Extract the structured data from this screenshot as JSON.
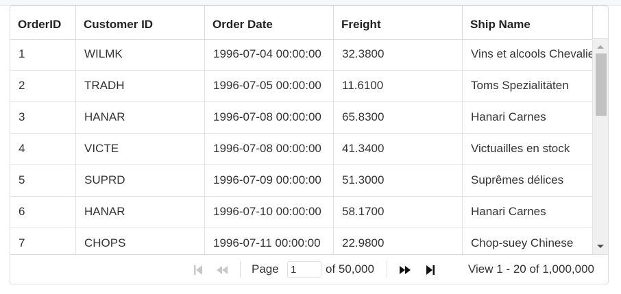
{
  "grid": {
    "columns": [
      "OrderID",
      "Customer ID",
      "Order Date",
      "Freight",
      "Ship Name"
    ],
    "rows": [
      [
        "1",
        "WILMK",
        "1996-07-04 00:00:00",
        "32.3800",
        "Vins et alcools Chevalier"
      ],
      [
        "2",
        "TRADH",
        "1996-07-05 00:00:00",
        "11.6100",
        "Toms Spezialitäten"
      ],
      [
        "3",
        "HANAR",
        "1996-07-08 00:00:00",
        "65.8300",
        "Hanari Carnes"
      ],
      [
        "4",
        "VICTE",
        "1996-07-08 00:00:00",
        "41.3400",
        "Victuailles en stock"
      ],
      [
        "5",
        "SUPRD",
        "1996-07-09 00:00:00",
        "51.3000",
        "Suprêmes délices"
      ],
      [
        "6",
        "HANAR",
        "1996-07-10 00:00:00",
        "58.1700",
        "Hanari Carnes"
      ],
      [
        "7",
        "CHOPS",
        "1996-07-11 00:00:00",
        "22.9800",
        "Chop-suey Chinese"
      ]
    ]
  },
  "pager": {
    "page_label": "Page",
    "page_value": "1",
    "of_label": "of 50,000",
    "view_label": "View 1 - 20 of 1,000,000",
    "icons": {
      "first": "first-page-icon",
      "prev": "previous-page-icon",
      "next": "next-page-icon",
      "last": "last-page-icon"
    }
  }
}
